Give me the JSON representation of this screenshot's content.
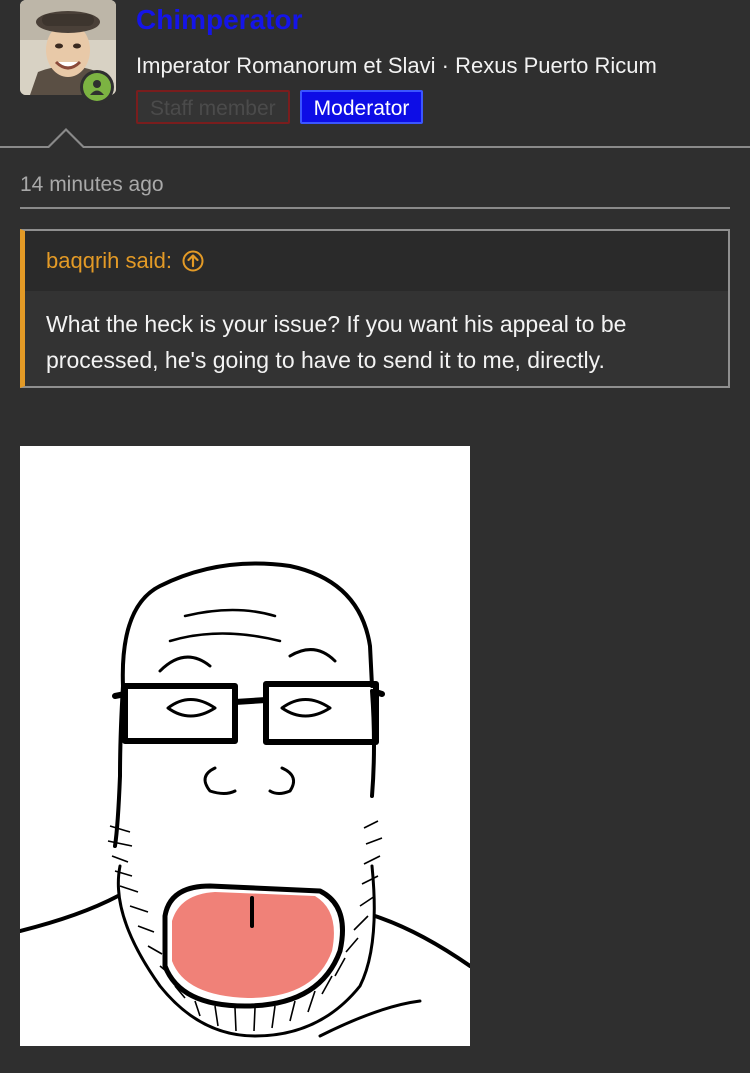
{
  "post": {
    "username": "Chimperator",
    "user_title": "Imperator Romanorum et Slavi · Rexus Puerto Ricum",
    "banners": {
      "staff": "Staff member",
      "moderator": "Moderator"
    },
    "timestamp": "14 minutes ago"
  },
  "quote": {
    "author_line": "baqqrih said:",
    "text": "What the heck is your issue? If you want his appeal to be processed, he's going to have to send it to me, directly."
  },
  "colors": {
    "background": "#2f2f2f",
    "username": "#1515e8",
    "quote_accent": "#e39a26",
    "moderator_banner": "#0d0de6",
    "online": "#7cb342"
  },
  "icons": {
    "online": "user-online-icon",
    "quote_jump": "arrow-up-circle-icon"
  }
}
